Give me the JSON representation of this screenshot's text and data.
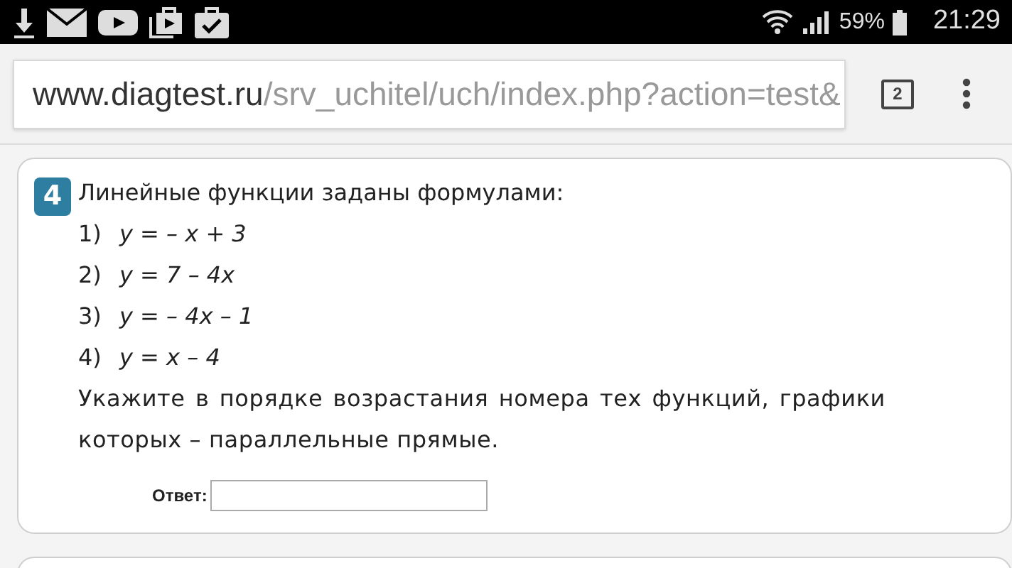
{
  "status_bar": {
    "battery": "59%",
    "time": "21:29"
  },
  "address_bar": {
    "domain": "www.diagtest.ru",
    "path": "/srv_uchitel/uch/index.php?action=test&",
    "tab_count": "2"
  },
  "task": {
    "number": "4",
    "intro": "Линейные функции заданы формулами:",
    "formulas": [
      {
        "index": "1)",
        "formula": "y = – x + 3"
      },
      {
        "index": "2)",
        "formula": "y = 7 – 4x"
      },
      {
        "index": "3)",
        "formula": "y = – 4x – 1"
      },
      {
        "index": "4)",
        "formula": "y = x – 4"
      }
    ],
    "question": "Укажите в порядке возрастания номера тех функций, графики которых – параллельные прямые.",
    "answer_label": "Ответ:"
  }
}
